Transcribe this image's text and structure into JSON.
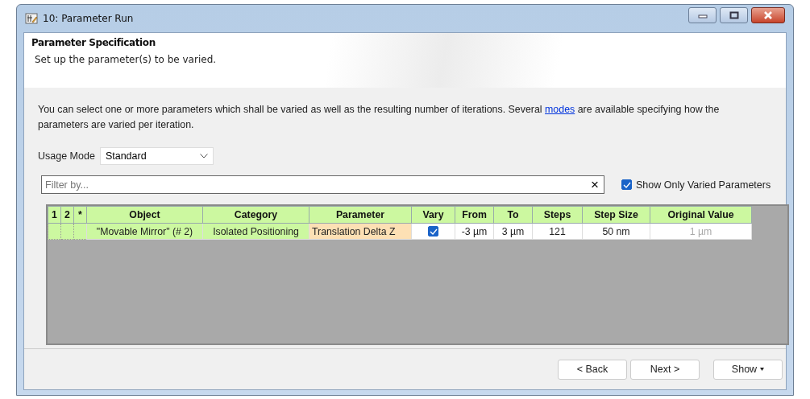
{
  "window": {
    "title": "10: Parameter Run"
  },
  "header": {
    "title": "Parameter Specification",
    "subtitle": "Set up the parameter(s) to be varied."
  },
  "intro": {
    "before": "You can select one or more parameters which shall be varied as well as the resulting number of iterations. Several",
    "link": "modes",
    "after": "are available specifying how the parameters are varied per iteration."
  },
  "usage_mode": {
    "label": "Usage Mode",
    "value": "Standard"
  },
  "filter": {
    "placeholder": "Filter by...",
    "clear": "×"
  },
  "show_only_varied": {
    "label": "Show Only Varied Parameters",
    "checked": true
  },
  "table": {
    "columns": [
      "1",
      "2",
      "*",
      "Object",
      "Category",
      "Parameter",
      "Vary",
      "From",
      "To",
      "Steps",
      "Step Size",
      "Original Value"
    ],
    "rows": [
      {
        "cells": [
          {
            "kind": "tree"
          },
          {
            "kind": "tree"
          },
          {
            "kind": "tree"
          },
          {
            "kind": "key",
            "text": "\"Movable Mirror\" (# 2)"
          },
          {
            "kind": "key",
            "text": "Isolated Positioning"
          },
          {
            "kind": "current",
            "text": "Translation Delta Z"
          },
          {
            "kind": "check",
            "checked": true
          },
          {
            "kind": "value",
            "text": "-3 µm"
          },
          {
            "kind": "value",
            "text": "3 µm"
          },
          {
            "kind": "value",
            "text": "121"
          },
          {
            "kind": "value",
            "text": "50 nm"
          },
          {
            "kind": "readonly",
            "text": "1 µm"
          }
        ]
      }
    ]
  },
  "buttons": [
    {
      "label": "< Back",
      "kind": "plain"
    },
    {
      "label": "Next >",
      "kind": "plain"
    },
    {
      "label": "Show",
      "kind": "menu"
    }
  ]
}
